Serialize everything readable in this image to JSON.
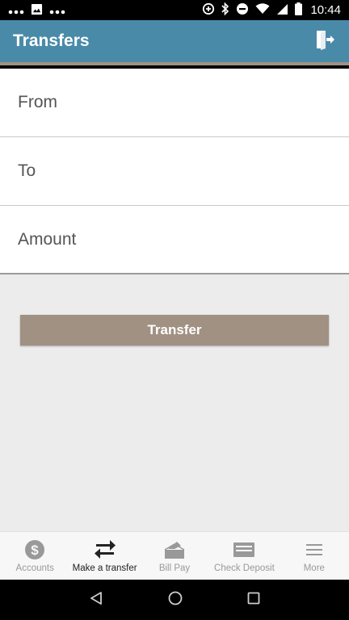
{
  "status": {
    "time": "10:44",
    "left_icons": [
      "dots-icon",
      "image-icon",
      "dots-icon"
    ],
    "right_icons": [
      "data-saver-icon",
      "bluetooth-icon",
      "dnd-icon",
      "wifi-icon",
      "signal-icon",
      "battery-icon"
    ]
  },
  "header": {
    "title": "Transfers",
    "background": "#4a8aa9",
    "accent": "#a19183",
    "logout_icon": "logout-icon"
  },
  "form": {
    "from_label": "From",
    "to_label": "To",
    "amount_label": "Amount"
  },
  "actions": {
    "transfer_label": "Transfer"
  },
  "bottom_nav": {
    "items": [
      {
        "label": "Accounts",
        "icon": "dollar-icon",
        "active": false
      },
      {
        "label": "Make a transfer",
        "icon": "transfer-arrows-icon",
        "active": true
      },
      {
        "label": "Bill Pay",
        "icon": "bill-pay-icon",
        "active": false
      },
      {
        "label": "Check Deposit",
        "icon": "check-deposit-icon",
        "active": false
      },
      {
        "label": "More",
        "icon": "menu-icon",
        "active": false
      }
    ]
  },
  "system_nav": [
    "back-icon",
    "home-icon",
    "recents-icon"
  ]
}
